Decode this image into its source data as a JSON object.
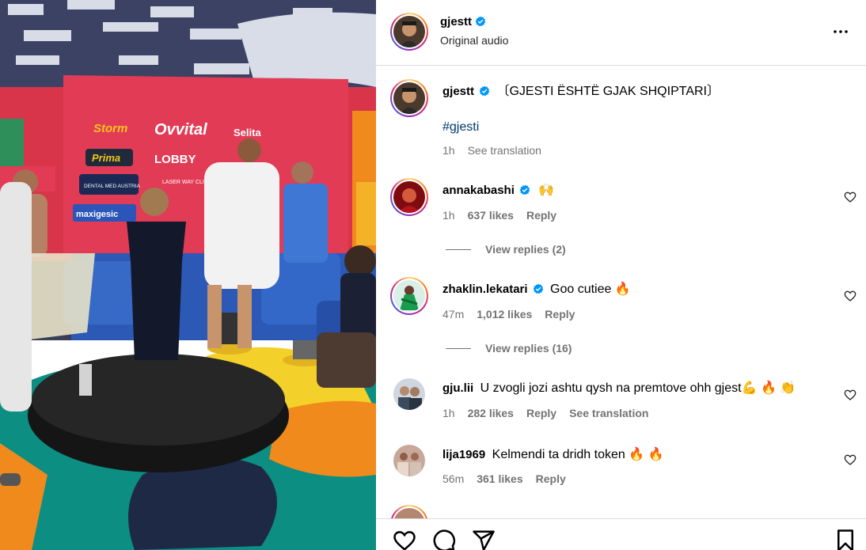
{
  "post": {
    "author": "gjestt",
    "audio": "Original audio",
    "caption": "〔GJESTI ËSHTË GJAK SHQIPTARI〕",
    "hashtag": "#gjesti",
    "time": "1h",
    "see_translation": "See translation"
  },
  "media_labels": {
    "storm": "Storm",
    "ovvital": "Ovvital",
    "selita": "Selita",
    "prima": "Prima",
    "lobby": "LOBBY",
    "dental": "DENTAL MED AUSTRIA",
    "maxi": "maxigesic",
    "laser": "LASER WAY CLINIC"
  },
  "comments": [
    {
      "user": "annakabashi",
      "verified": true,
      "text": "🙌",
      "time": "1h",
      "likes": "637 likes",
      "reply": "Reply",
      "view_replies": "View replies (2)"
    },
    {
      "user": "zhaklin.lekatari",
      "verified": true,
      "text": "Goo cutiee 🔥",
      "time": "47m",
      "likes": "1,012 likes",
      "reply": "Reply",
      "view_replies": "View replies (16)"
    },
    {
      "user": "gju.lii",
      "verified": false,
      "text": "U zvogli jozi ashtu qysh na premtove ohh gjest💪 🔥 👏",
      "time": "1h",
      "likes": "282 likes",
      "reply": "Reply",
      "see_translation": "See translation"
    },
    {
      "user": "lija1969",
      "verified": false,
      "text": "Kelmendi ta dridh token 🔥 🔥",
      "time": "56m",
      "likes": "361 likes",
      "reply": "Reply"
    }
  ],
  "icons": {
    "more": "more-options-icon",
    "like": "heart-icon",
    "comment": "comment-icon",
    "share": "share-icon",
    "save": "bookmark-icon",
    "verified": "verified-badge-icon"
  },
  "colors": {
    "verified": "#0095f6",
    "meta": "#737373",
    "hashtag": "#00376b",
    "divider": "#dbdbdb"
  }
}
